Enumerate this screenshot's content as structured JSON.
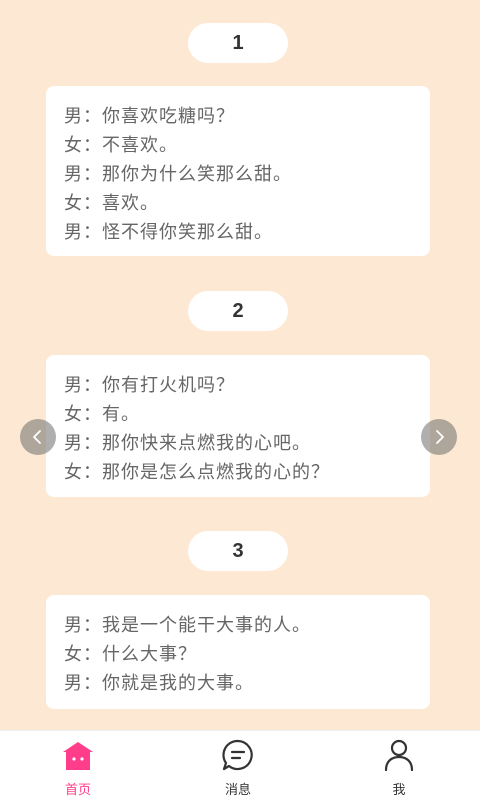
{
  "sections": [
    {
      "number": "1",
      "lines": [
        "男：你喜欢吃糖吗？",
        "女：不喜欢。",
        "男：那你为什么笑那么甜。",
        "女：喜欢。",
        "男：怪不得你笑那么甜。"
      ]
    },
    {
      "number": "2",
      "lines": [
        "男：你有打火机吗？",
        "女：有。",
        "男：那你快来点燃我的心吧。",
        "女：那你是怎么点燃我的心的？"
      ]
    },
    {
      "number": "3",
      "lines": [
        "男：我是一个能干大事的人。",
        "女：什么大事？",
        "男：你就是我的大事。"
      ]
    }
  ],
  "carousel": {
    "prev_icon": "chevron-left-icon",
    "next_icon": "chevron-right-icon"
  },
  "tabbar": {
    "items": [
      {
        "label": "首页",
        "icon": "home-icon",
        "active": true
      },
      {
        "label": "消息",
        "icon": "message-icon",
        "active": false
      },
      {
        "label": "我",
        "icon": "user-icon",
        "active": false
      }
    ],
    "active_color": "#ff3d8b"
  },
  "colors": {
    "background": "#fde8d3",
    "card": "#ffffff",
    "text": "#666666"
  }
}
